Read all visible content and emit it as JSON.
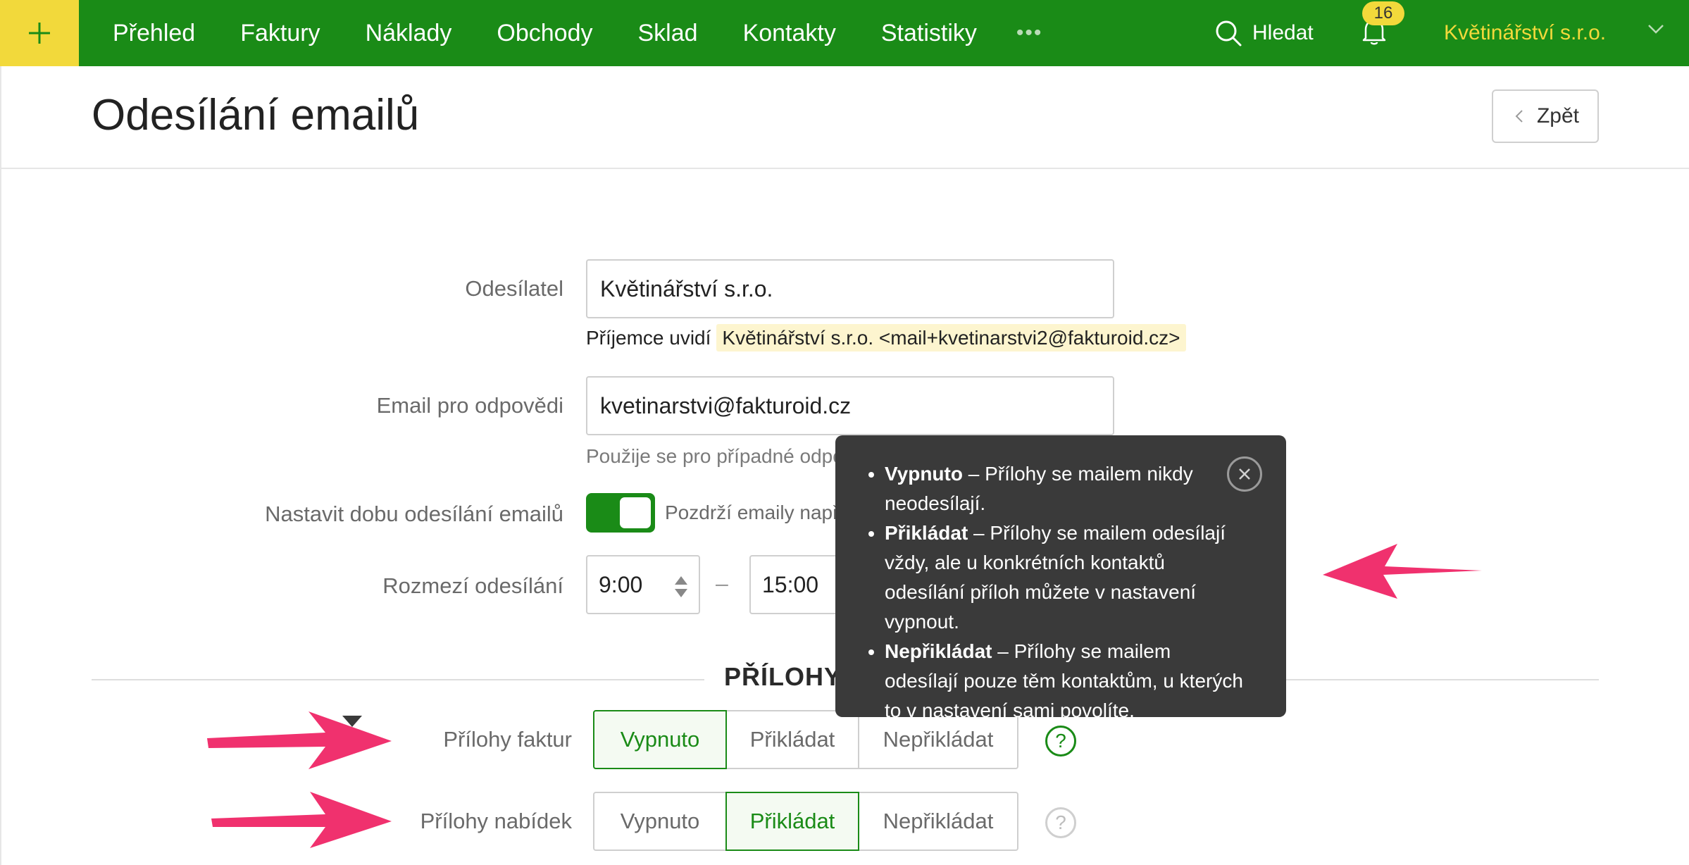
{
  "topbar": {
    "nav": [
      "Přehled",
      "Faktury",
      "Náklady",
      "Obchody",
      "Sklad",
      "Kontakty",
      "Statistiky"
    ],
    "more": "•••",
    "search_label": "Hledat",
    "notifications_count": "16",
    "account_name": "Květinářství s.r.o."
  },
  "header": {
    "title": "Odesílání emailů",
    "back_label": "Zpět"
  },
  "form": {
    "sender_label": "Odesílatel",
    "sender_value": "Květinářství s.r.o.",
    "sender_hint_prefix": "Příjemce uvidí",
    "sender_hint_value": "Květinářství s.r.o. <mail+kvetinarstvi2@fakturoid.cz>",
    "reply_label": "Email pro odpovědi",
    "reply_value": "kvetinarstvi@fakturoid.cz",
    "reply_hint": "Použije se pro případné odpovědi, které pošle klient.",
    "schedule_label": "Nastavit dobu odesílání emailů",
    "schedule_hint": "Pozdrží emaily např. na začátek pracovní doby.",
    "range_label": "Rozmezí odesílání",
    "range_from": "9:00",
    "range_dash": "–",
    "range_to": "15:00"
  },
  "attachments": {
    "section_title": "PŘÍLOHY V EMAILU",
    "rows": [
      {
        "label": "Přílohy faktur",
        "options": [
          "Vypnuto",
          "Přikládat",
          "Nepřikládat"
        ],
        "selected": "Vypnuto"
      },
      {
        "label": "Přílohy nabídek",
        "options": [
          "Vypnuto",
          "Přikládat",
          "Nepřikládat"
        ],
        "selected": "Přikládat"
      }
    ],
    "help_glyph": "?"
  },
  "tooltip": {
    "items": [
      {
        "term": "Vypnuto",
        "text": " – Přílohy se mailem nikdy neodesílají."
      },
      {
        "term": "Přikládat",
        "text": " – Přílohy se mailem odesílají vždy, ale u konkrétních kontaktů odesílání příloh můžete v nastavení vypnout."
      },
      {
        "term": "Nepřikládat",
        "text": " – Přílohy se mailem odesílají pouze těm kontaktům, u kterých to v nastavení sami povolíte."
      }
    ]
  },
  "colors": {
    "brand_green": "#1a8b17",
    "accent_yellow": "#f2d93b",
    "annotation_pink": "#f0316e",
    "tooltip_bg": "#3a3a3a"
  }
}
